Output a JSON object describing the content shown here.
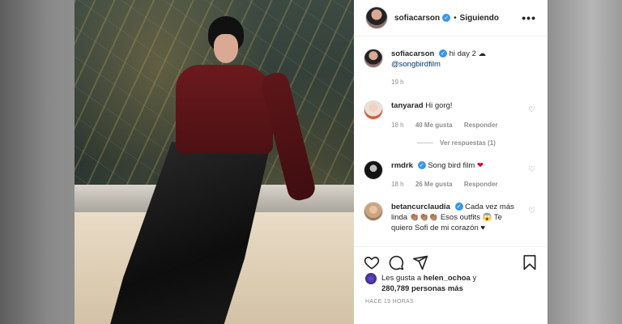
{
  "header": {
    "username": "sofiacarson",
    "separator": "•",
    "follow_status": "Siguiendo",
    "more_glyph": "•••",
    "verified_glyph": "✓"
  },
  "caption": {
    "username": "sofiacarson",
    "text": "hi day 2 ☁",
    "mention": "@songbirdfilm",
    "time": "19 h"
  },
  "comments": [
    {
      "username": "tanyarad",
      "verified": false,
      "text": "Hi gorg!",
      "time": "18 h",
      "likes": "40 Me gusta",
      "reply": "Responder",
      "view_replies": "Ver respuestas (1)"
    },
    {
      "username": "rmdrk",
      "verified": true,
      "text": "Song bird film",
      "emoji": "❤",
      "time": "18 h",
      "likes": "26 Me gusta",
      "reply": "Responder"
    },
    {
      "username": "betancurclaudia",
      "verified": true,
      "text": "Cada vez más linda 👏🏽👏🏽👏🏽 Esos outfits 😱 Te quiero Sofi de mi corazón ♥"
    }
  ],
  "actions": {
    "icons": [
      "heart-icon",
      "comment-icon",
      "share-icon",
      "bookmark-icon"
    ]
  },
  "likes": {
    "prefix": "Les gusta a",
    "user": "helen_ochoa",
    "connector": "y",
    "count": "280,789 personas más"
  },
  "timestamp": "HACE 19 HORAS",
  "colors": {
    "verified": "#3897f0",
    "link": "#00376b",
    "heart_red": "#ed4956",
    "muted": "#8e8e8e"
  }
}
